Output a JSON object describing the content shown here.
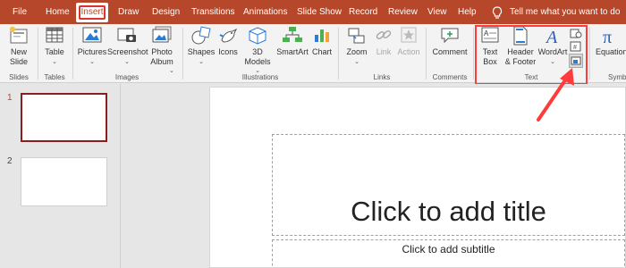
{
  "menu": {
    "tabs": [
      "File",
      "Home",
      "Insert",
      "Draw",
      "Design",
      "Transitions",
      "Animations",
      "Slide Show",
      "Record",
      "Review",
      "View",
      "Help"
    ],
    "tell_me": "Tell me what you want to do"
  },
  "ribbon": {
    "new_slide": {
      "line1": "New",
      "line2": "Slide"
    },
    "table": "Table",
    "pictures": "Pictures",
    "screenshot": "Screenshot",
    "photo_album": {
      "line1": "Photo",
      "line2": "Album"
    },
    "shapes": "Shapes",
    "icons": "Icons",
    "models_3d": {
      "line1": "3D",
      "line2": "Models"
    },
    "smartart": "SmartArt",
    "chart": "Chart",
    "zoom": "Zoom",
    "link": "Link",
    "action": "Action",
    "comment": "Comment",
    "text_box": {
      "line1": "Text",
      "line2": "Box"
    },
    "header_footer": {
      "line1": "Header",
      "line2": "& Footer"
    },
    "wordart": "WordArt",
    "equation": "Equation",
    "groups": {
      "slides": "Slides",
      "tables": "Tables",
      "images": "Images",
      "illustrations": "Illustrations",
      "links": "Links",
      "comments": "Comments",
      "text": "Text",
      "symbols": "Symb"
    }
  },
  "thumbnails": {
    "numbers": [
      "1",
      "2"
    ]
  },
  "slide": {
    "title_placeholder": "Click to add title",
    "subtitle_placeholder": "Click to add subtitle"
  },
  "colors": {
    "accent": "#b7472a",
    "highlight": "#ff3b3b"
  }
}
